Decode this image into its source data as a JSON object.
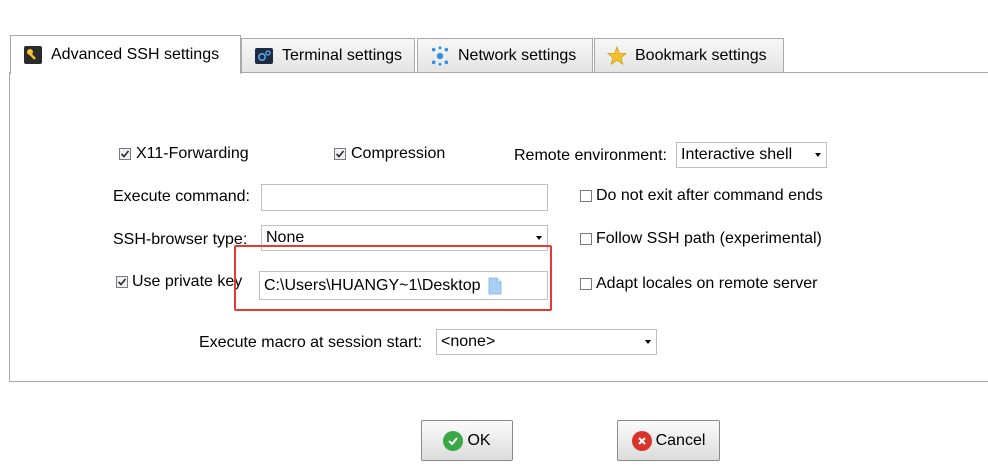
{
  "tabs": [
    {
      "label": "Advanced SSH settings",
      "icon": "key-icon",
      "active": true
    },
    {
      "label": "Terminal settings",
      "icon": "terminal-gear-icon",
      "active": false
    },
    {
      "label": "Network settings",
      "icon": "network-icon",
      "active": false
    },
    {
      "label": "Bookmark settings",
      "icon": "star-icon",
      "active": false
    }
  ],
  "options": {
    "x11_forwarding": {
      "label": "X11-Forwarding",
      "checked": true
    },
    "compression": {
      "label": "Compression",
      "checked": true
    },
    "remote_env": {
      "label": "Remote environment:",
      "value": "Interactive shell"
    },
    "execute_command": {
      "label": "Execute command:",
      "value": ""
    },
    "do_not_exit": {
      "label": "Do not exit after command ends",
      "checked": false
    },
    "ssh_browser": {
      "label": "SSH-browser type:",
      "value": "None"
    },
    "follow_ssh_path": {
      "label": "Follow SSH path (experimental)",
      "checked": false
    },
    "private_key": {
      "label": "Use private key",
      "checked": true,
      "value": "C:\\Users\\HUANGY~1\\Desktop"
    },
    "adapt_locales": {
      "label": "Adapt locales on remote server",
      "checked": false
    },
    "macro": {
      "label": "Execute macro at session start:",
      "value": "<none>"
    }
  },
  "buttons": {
    "ok": "OK",
    "cancel": "Cancel"
  },
  "colors": {
    "highlight": "#e53935",
    "ok_icon": "#3aa845",
    "cancel_icon": "#d9342b"
  }
}
